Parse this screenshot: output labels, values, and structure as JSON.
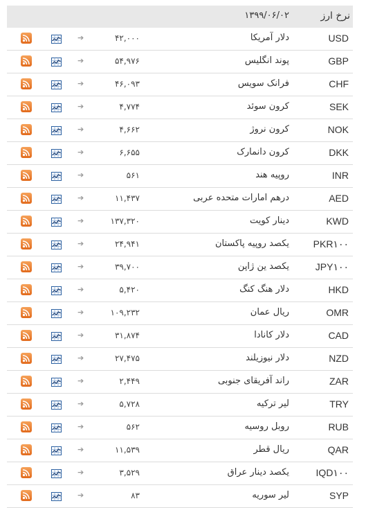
{
  "header": {
    "title": "نرخ ارز",
    "date": "۱۳۹۹/۰۶/۰۲"
  },
  "icons": {
    "rss": "rss-feed-icon",
    "chart": "line-chart-icon",
    "arrow": "arrow-right-icon"
  },
  "rows": [
    {
      "code": "USD",
      "name": "دلار آمریکا",
      "price": "۴۲,۰۰۰"
    },
    {
      "code": "GBP",
      "name": "پوند انگلیس",
      "price": "۵۴,۹۷۶"
    },
    {
      "code": "CHF",
      "name": "فرانک سویس",
      "price": "۴۶,۰۹۳"
    },
    {
      "code": "SEK",
      "name": "کرون سوئد",
      "price": "۴,۷۷۴"
    },
    {
      "code": "NOK",
      "name": "کرون نروژ",
      "price": "۴,۶۶۲"
    },
    {
      "code": "DKK",
      "name": "کرون دانمارک",
      "price": "۶,۶۵۵"
    },
    {
      "code": "INR",
      "name": "روپیه هند",
      "price": "۵۶۱"
    },
    {
      "code": "AED",
      "name": "درهم امارات متحده عربی",
      "price": "۱۱,۴۳۷"
    },
    {
      "code": "KWD",
      "name": "دینار کویت",
      "price": "۱۳۷,۳۲۰"
    },
    {
      "code": "PKR۱۰۰",
      "name": "یکصد روپیه پاکستان",
      "price": "۲۴,۹۴۱"
    },
    {
      "code": "JPY۱۰۰",
      "name": "یکصد ین ژاپن",
      "price": "۳۹,۷۰۰"
    },
    {
      "code": "HKD",
      "name": "دلار هنگ کنگ",
      "price": "۵,۴۲۰"
    },
    {
      "code": "OMR",
      "name": "ریال عمان",
      "price": "۱۰۹,۲۳۲"
    },
    {
      "code": "CAD",
      "name": "دلار کانادا",
      "price": "۳۱,۸۷۴"
    },
    {
      "code": "NZD",
      "name": "دلار نیوزیلند",
      "price": "۲۷,۴۷۵"
    },
    {
      "code": "ZAR",
      "name": "راند آفریقای جنوبی",
      "price": "۲,۴۴۹"
    },
    {
      "code": "TRY",
      "name": "لیر ترکیه",
      "price": "۵,۷۲۸"
    },
    {
      "code": "RUB",
      "name": "روبل روسیه",
      "price": "۵۶۲"
    },
    {
      "code": "QAR",
      "name": "ریال قطر",
      "price": "۱۱,۵۳۹"
    },
    {
      "code": "IQD۱۰۰",
      "name": "یکصد دینار عراق",
      "price": "۳,۵۲۹"
    },
    {
      "code": "SYP",
      "name": "لیر سوریه",
      "price": "۸۳"
    }
  ]
}
